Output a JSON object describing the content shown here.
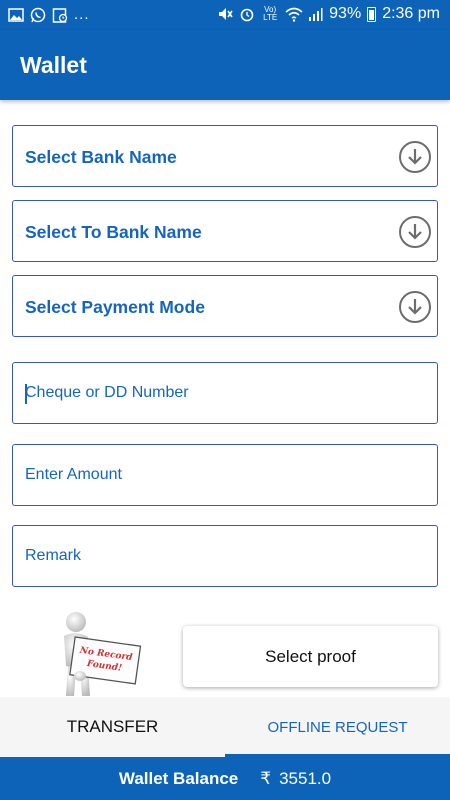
{
  "status_bar": {
    "dots": "...",
    "volte": "Vo) LTE",
    "battery": "93%",
    "time": "2:36 pm"
  },
  "app_bar": {
    "title": "Wallet"
  },
  "form": {
    "bank_name": "Select Bank Name",
    "to_bank_name": "Select To Bank Name",
    "payment_mode": "Select Payment Mode",
    "cheque_placeholder": "Cheque or DD Number",
    "amount_placeholder": "Enter Amount",
    "remark_placeholder": "Remark"
  },
  "proof": {
    "figure_sign": "No Record Found!",
    "select_proof": "Select proof"
  },
  "tabs": {
    "transfer": "TRANSFER",
    "offline_request": "OFFLINE REQUEST"
  },
  "balance": {
    "label": "Wallet Balance",
    "currency": "₹",
    "value": "3551.0"
  },
  "colors": {
    "primary": "#0d63b8",
    "text_blue": "#1565c0"
  }
}
